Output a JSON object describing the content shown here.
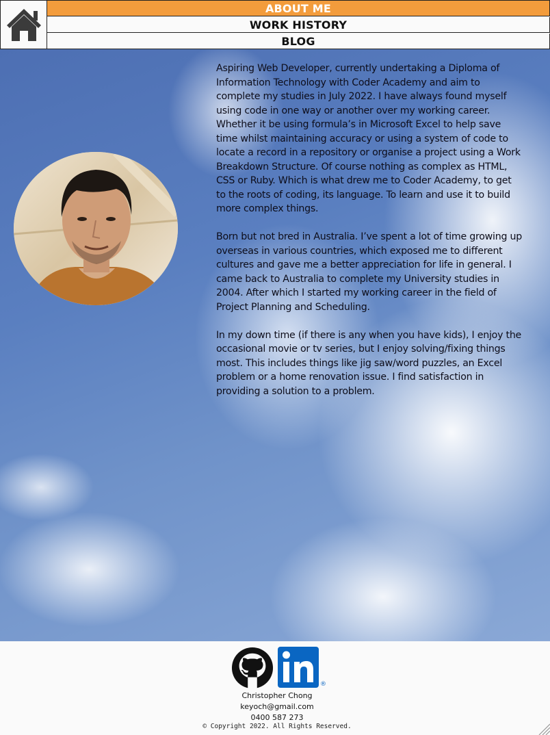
{
  "nav": {
    "home_icon": "house-icon",
    "items": [
      {
        "label": "ABOUT ME",
        "active": true
      },
      {
        "label": "WORK HISTORY",
        "active": false
      },
      {
        "label": "BLOG",
        "active": false
      }
    ],
    "active_color": "#f39c3c"
  },
  "about": {
    "paragraphs": [
      "Aspiring Web Developer, currently undertaking a Diploma of Information Technology with Coder Academy and aim to complete my studies in July 2022. I have always found myself using code in one way or another over my working career. Whether it be using formula’s in Microsoft Excel to help save time whilst maintaining accuracy or using a system of code to locate a record in a repository or organise a project using a Work Breakdown Structure. Of course nothing as complex as HTML, CSS or Ruby. Which is what drew me to Coder Academy, to get to the roots of coding, its language. To learn and use it to build more complex things.",
      "Born but not bred in Australia. I’ve spent a lot of time growing up overseas in various countries, which exposed me to different cultures and gave me a better appreciation for life in general. I came back to Australia to complete my University studies in 2004. After which I started my working career in the field of Project Planning and Scheduling.",
      "In my down time (if there is any when you have kids), I enjoy the occasional movie or tv series, but I enjoy solving/fixing things most. This includes things like jig saw/word puzzles, an Excel problem or a home renovation issue. I find satisfaction in providing a solution to a problem."
    ]
  },
  "footer": {
    "github_icon": "github-icon",
    "linkedin_icon": "linkedin-icon",
    "linkedin_text": "in",
    "linkedin_reg": "®",
    "name": "Christopher Chong",
    "email": "keyoch@gmail.com",
    "phone": "0400 587 273",
    "copyright": "© Copyright 2022. All Rights Reserved."
  }
}
